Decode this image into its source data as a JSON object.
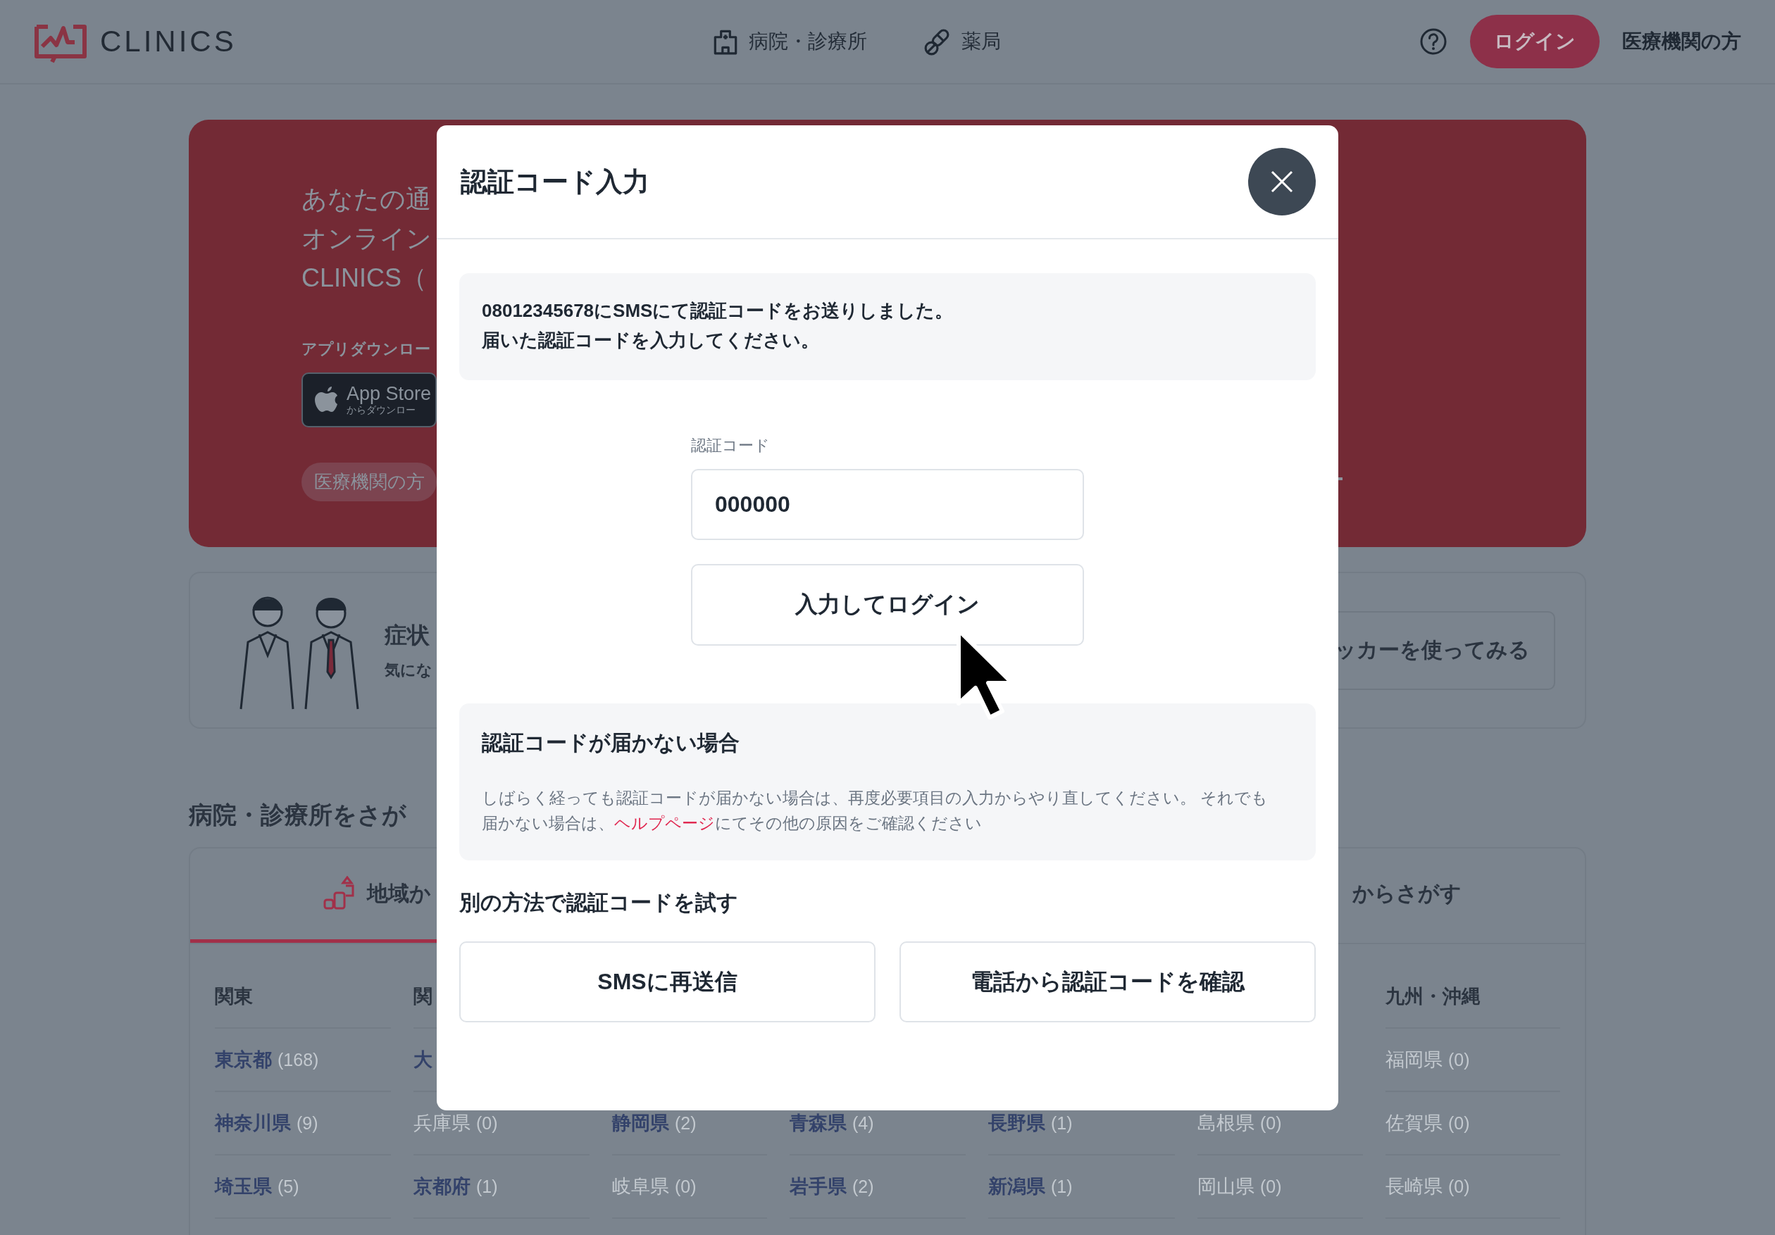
{
  "header": {
    "logo_text": "CLINICS",
    "nav": [
      {
        "label": "病院・診療所"
      },
      {
        "label": "薬局"
      }
    ],
    "login_button": "ログイン",
    "institution_link": "医療機関の方"
  },
  "hero": {
    "headline_lines": [
      "あなたの通",
      "オンライン",
      "CLINICS（"
    ],
    "download_label": "アプリダウンロー",
    "app_store": {
      "title": "App Store",
      "subtitle": "からダウンロー"
    },
    "institution_pill": "医療機関の方"
  },
  "symptom_banner": {
    "title": "症状",
    "subtitle": "気にな",
    "button": "ッカーを使ってみる"
  },
  "search_section": {
    "title": "病院・診療所をさが",
    "tabs": [
      {
        "label": "地域か",
        "selected": true
      },
      {
        "label": "からさがす",
        "selected": false
      }
    ],
    "regions": [
      {
        "header": "関東",
        "items": [
          {
            "name": "東京都",
            "count": "(168)",
            "disabled": false
          },
          {
            "name": "神奈川県",
            "count": "(9)",
            "disabled": false
          },
          {
            "name": "埼玉県",
            "count": "(5)",
            "disabled": false
          }
        ]
      },
      {
        "header": "関",
        "items": [
          {
            "name": "大",
            "disabled": false
          },
          {
            "name": "兵庫県",
            "count": "(0)",
            "disabled": true
          },
          {
            "name": "京都府",
            "count": "(1)",
            "disabled": false
          }
        ]
      },
      {
        "items": [
          {
            "name": "静岡県",
            "count": "(2)",
            "disabled": false
          },
          {
            "name": "岐阜県",
            "count": "(0)",
            "disabled": true
          }
        ]
      },
      {
        "items": [
          {
            "name": "青森県",
            "count": "(4)",
            "disabled": false
          },
          {
            "name": "岩手県",
            "count": "(2)",
            "disabled": false
          }
        ]
      },
      {
        "items": [
          {
            "name": "長野県",
            "count": "(1)",
            "disabled": false
          },
          {
            "name": "新潟県",
            "count": "(1)",
            "disabled": false
          }
        ]
      },
      {
        "items": [
          {
            "name": "島根県",
            "count": "(0)",
            "disabled": true
          },
          {
            "name": "岡山県",
            "count": "(0)",
            "disabled": true
          }
        ]
      },
      {
        "header": "九州・沖縄",
        "items": [
          {
            "name": "福岡県",
            "count": "(0)",
            "disabled": true
          },
          {
            "name": "佐賀県",
            "count": "(0)",
            "disabled": true
          },
          {
            "name": "長崎県",
            "count": "(0)",
            "disabled": true
          }
        ]
      }
    ]
  },
  "modal": {
    "title": "認証コード入力",
    "message_lines": [
      "08012345678にSMSにて認証コードをお送りしました。",
      "届いた認証コードを入力してください。"
    ],
    "code_field": {
      "label": "認証コード",
      "value": "000000"
    },
    "submit_button": "入力してログイン",
    "help": {
      "title": "認証コードが届かない場合",
      "text": "しばらく経っても認証コードが届かない場合は、再度必要項目の入力からやり直してください。 それでも届かない場合は、",
      "link": "ヘルプページ",
      "text_after": "にてその他の原因をご確認ください"
    },
    "alternatives": {
      "title": "別の方法で認証コードを試す",
      "buttons": [
        "SMSに再送信",
        "電話から認証コードを確認"
      ]
    }
  }
}
